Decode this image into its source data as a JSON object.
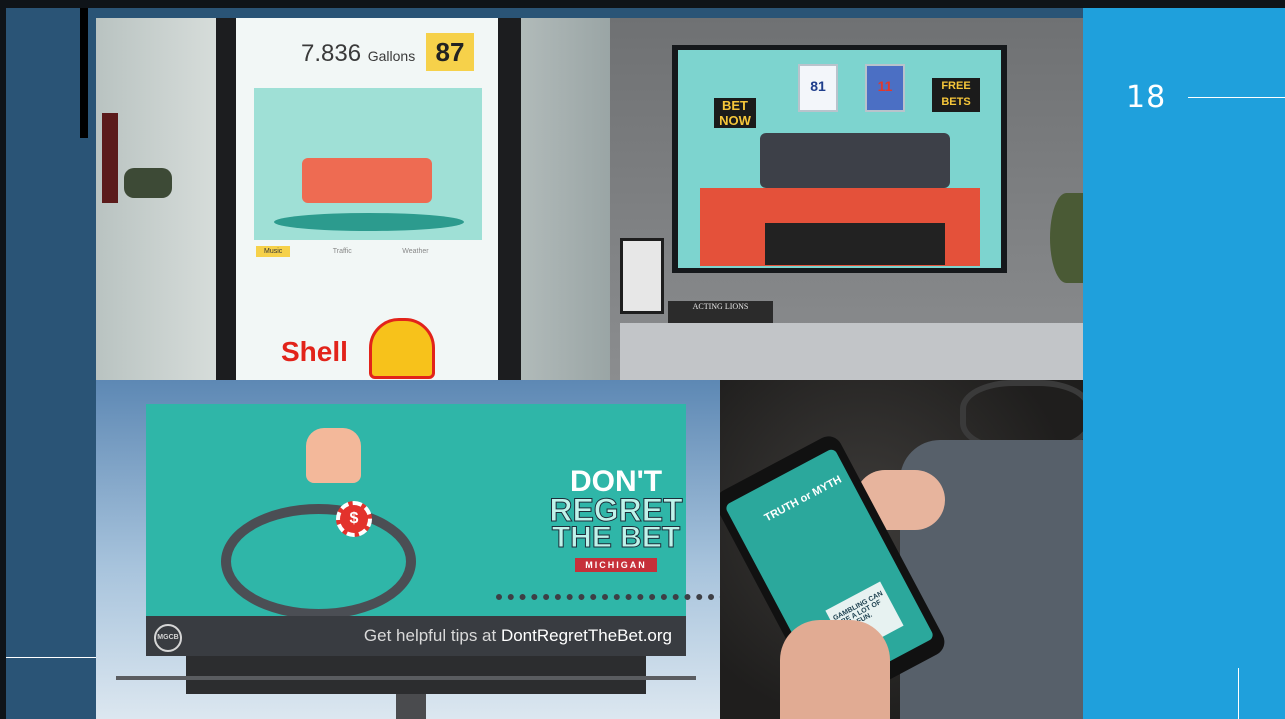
{
  "slide": {
    "number": "18",
    "colors": {
      "background": "#2a5476",
      "accent_panel": "#1fa0dc"
    }
  },
  "images": {
    "pump": {
      "gallons_value": "7.836",
      "gallons_unit": "Gallons",
      "grade": "87",
      "tabs": [
        "Music",
        "Traffic",
        "Weather"
      ],
      "brand_text": "Shell"
    },
    "tv": {
      "bet_now": "BET NOW",
      "free_bets": "FREE BETS",
      "jersey_left": "81",
      "jersey_right": "11",
      "book_title": "ACTING LIONS"
    },
    "billboard": {
      "title_line1": "DON'T",
      "title_line2": "REGRET",
      "title_line3": "THE BET",
      "state": "MICHIGAN",
      "logo_text": "MGCB",
      "footer_prefix": "Get helpful tips at ",
      "footer_url": "DontRegretTheBet.org"
    },
    "phone": {
      "headline": "TRUTH or MYTH",
      "card_text": "GAMBLING CAN BE A LOT OF FUN."
    }
  }
}
